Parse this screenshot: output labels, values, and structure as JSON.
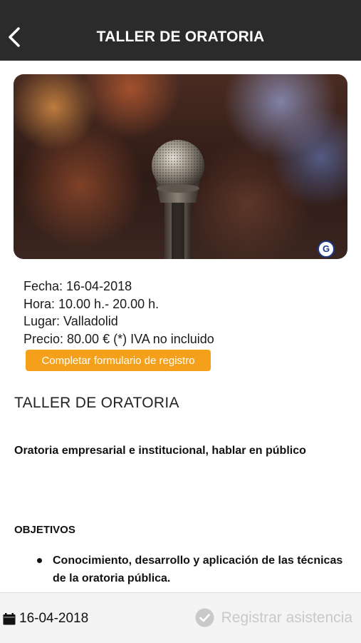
{
  "header": {
    "title": "TALLER DE ORATORIA"
  },
  "hero": {
    "badge_letter": "G"
  },
  "event_info": {
    "fecha": "Fecha: 16-04-2018",
    "hora": "Hora: 10.00 h.- 20.00 h.",
    "lugar": "Lugar: Valladolid",
    "precio": "Precio: 80.00 € (*) IVA no incluido"
  },
  "register_button": {
    "label": "Completar formulario de registro",
    "color": "#f5a01a"
  },
  "content": {
    "title": "TALLER DE ORATORIA",
    "subtitle": "Oratoria empresarial e institucional, hablar en público",
    "objectives_heading": "OBJETIVOS",
    "objectives": [
      "Conocimiento, desarrollo y aplicación de las técnicas de la oratoria pública."
    ]
  },
  "footer": {
    "date": "16-04-2018",
    "attend_label": "Registrar asistencia",
    "attend_color": "#c9c9c9"
  },
  "icons": {
    "back": "chevron-left-icon",
    "calendar": "calendar-icon",
    "check": "check-circle-icon"
  }
}
